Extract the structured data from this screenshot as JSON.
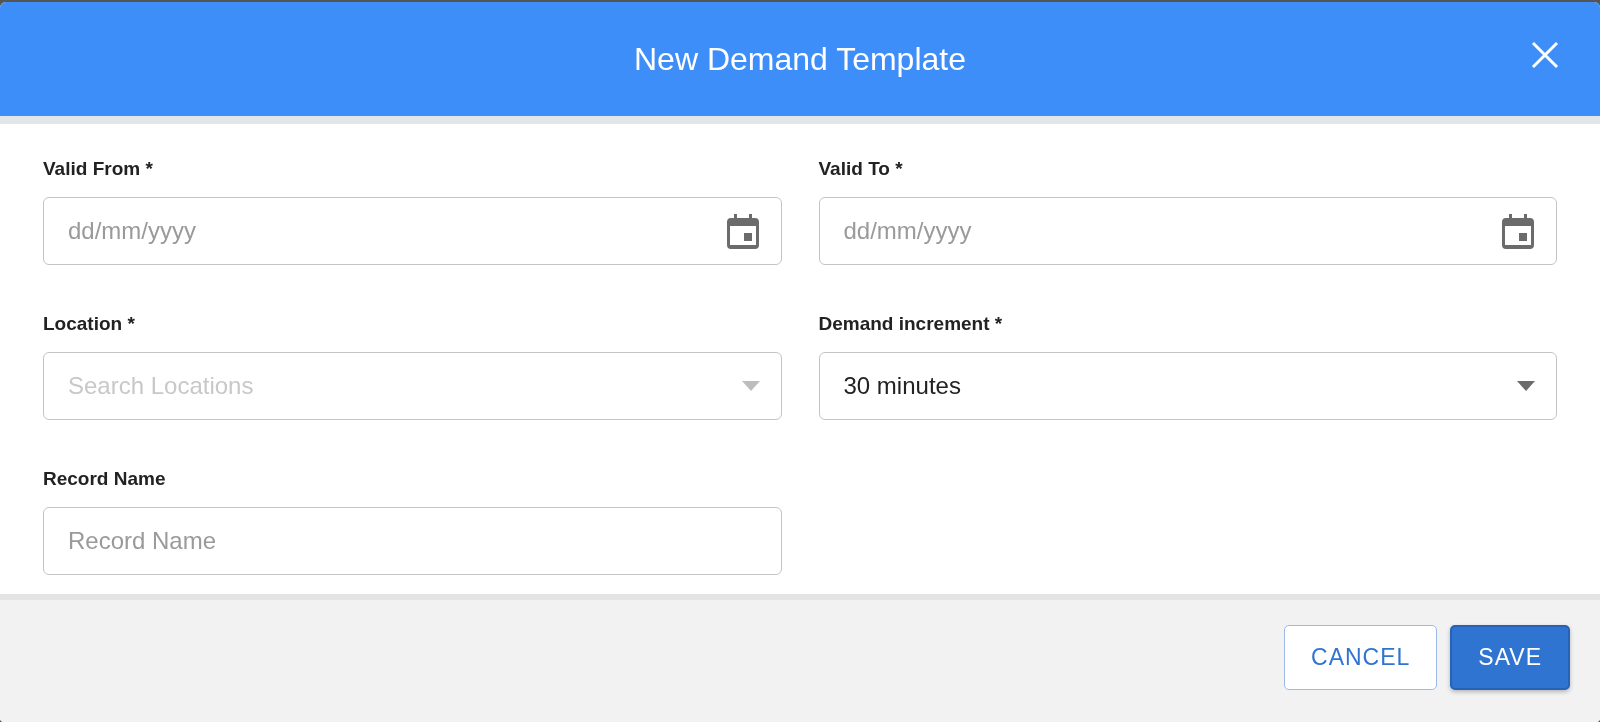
{
  "dialog": {
    "title": "New Demand Template"
  },
  "fields": [
    {
      "label": "Valid From *",
      "kind": "date",
      "placeholder": "dd/mm/yyyy"
    },
    {
      "label": "Valid To *",
      "kind": "date",
      "placeholder": "dd/mm/yyyy"
    },
    {
      "label": "Location *",
      "kind": "select",
      "placeholder": "Search Locations"
    },
    {
      "label": "Demand increment *",
      "kind": "select",
      "value": "30 minutes"
    },
    {
      "label": "Record Name",
      "kind": "text",
      "placeholder": "Record Name"
    }
  ],
  "buttons": [
    {
      "label": "CANCEL",
      "kind": "secondary"
    },
    {
      "label": "SAVE",
      "kind": "primary"
    }
  ]
}
